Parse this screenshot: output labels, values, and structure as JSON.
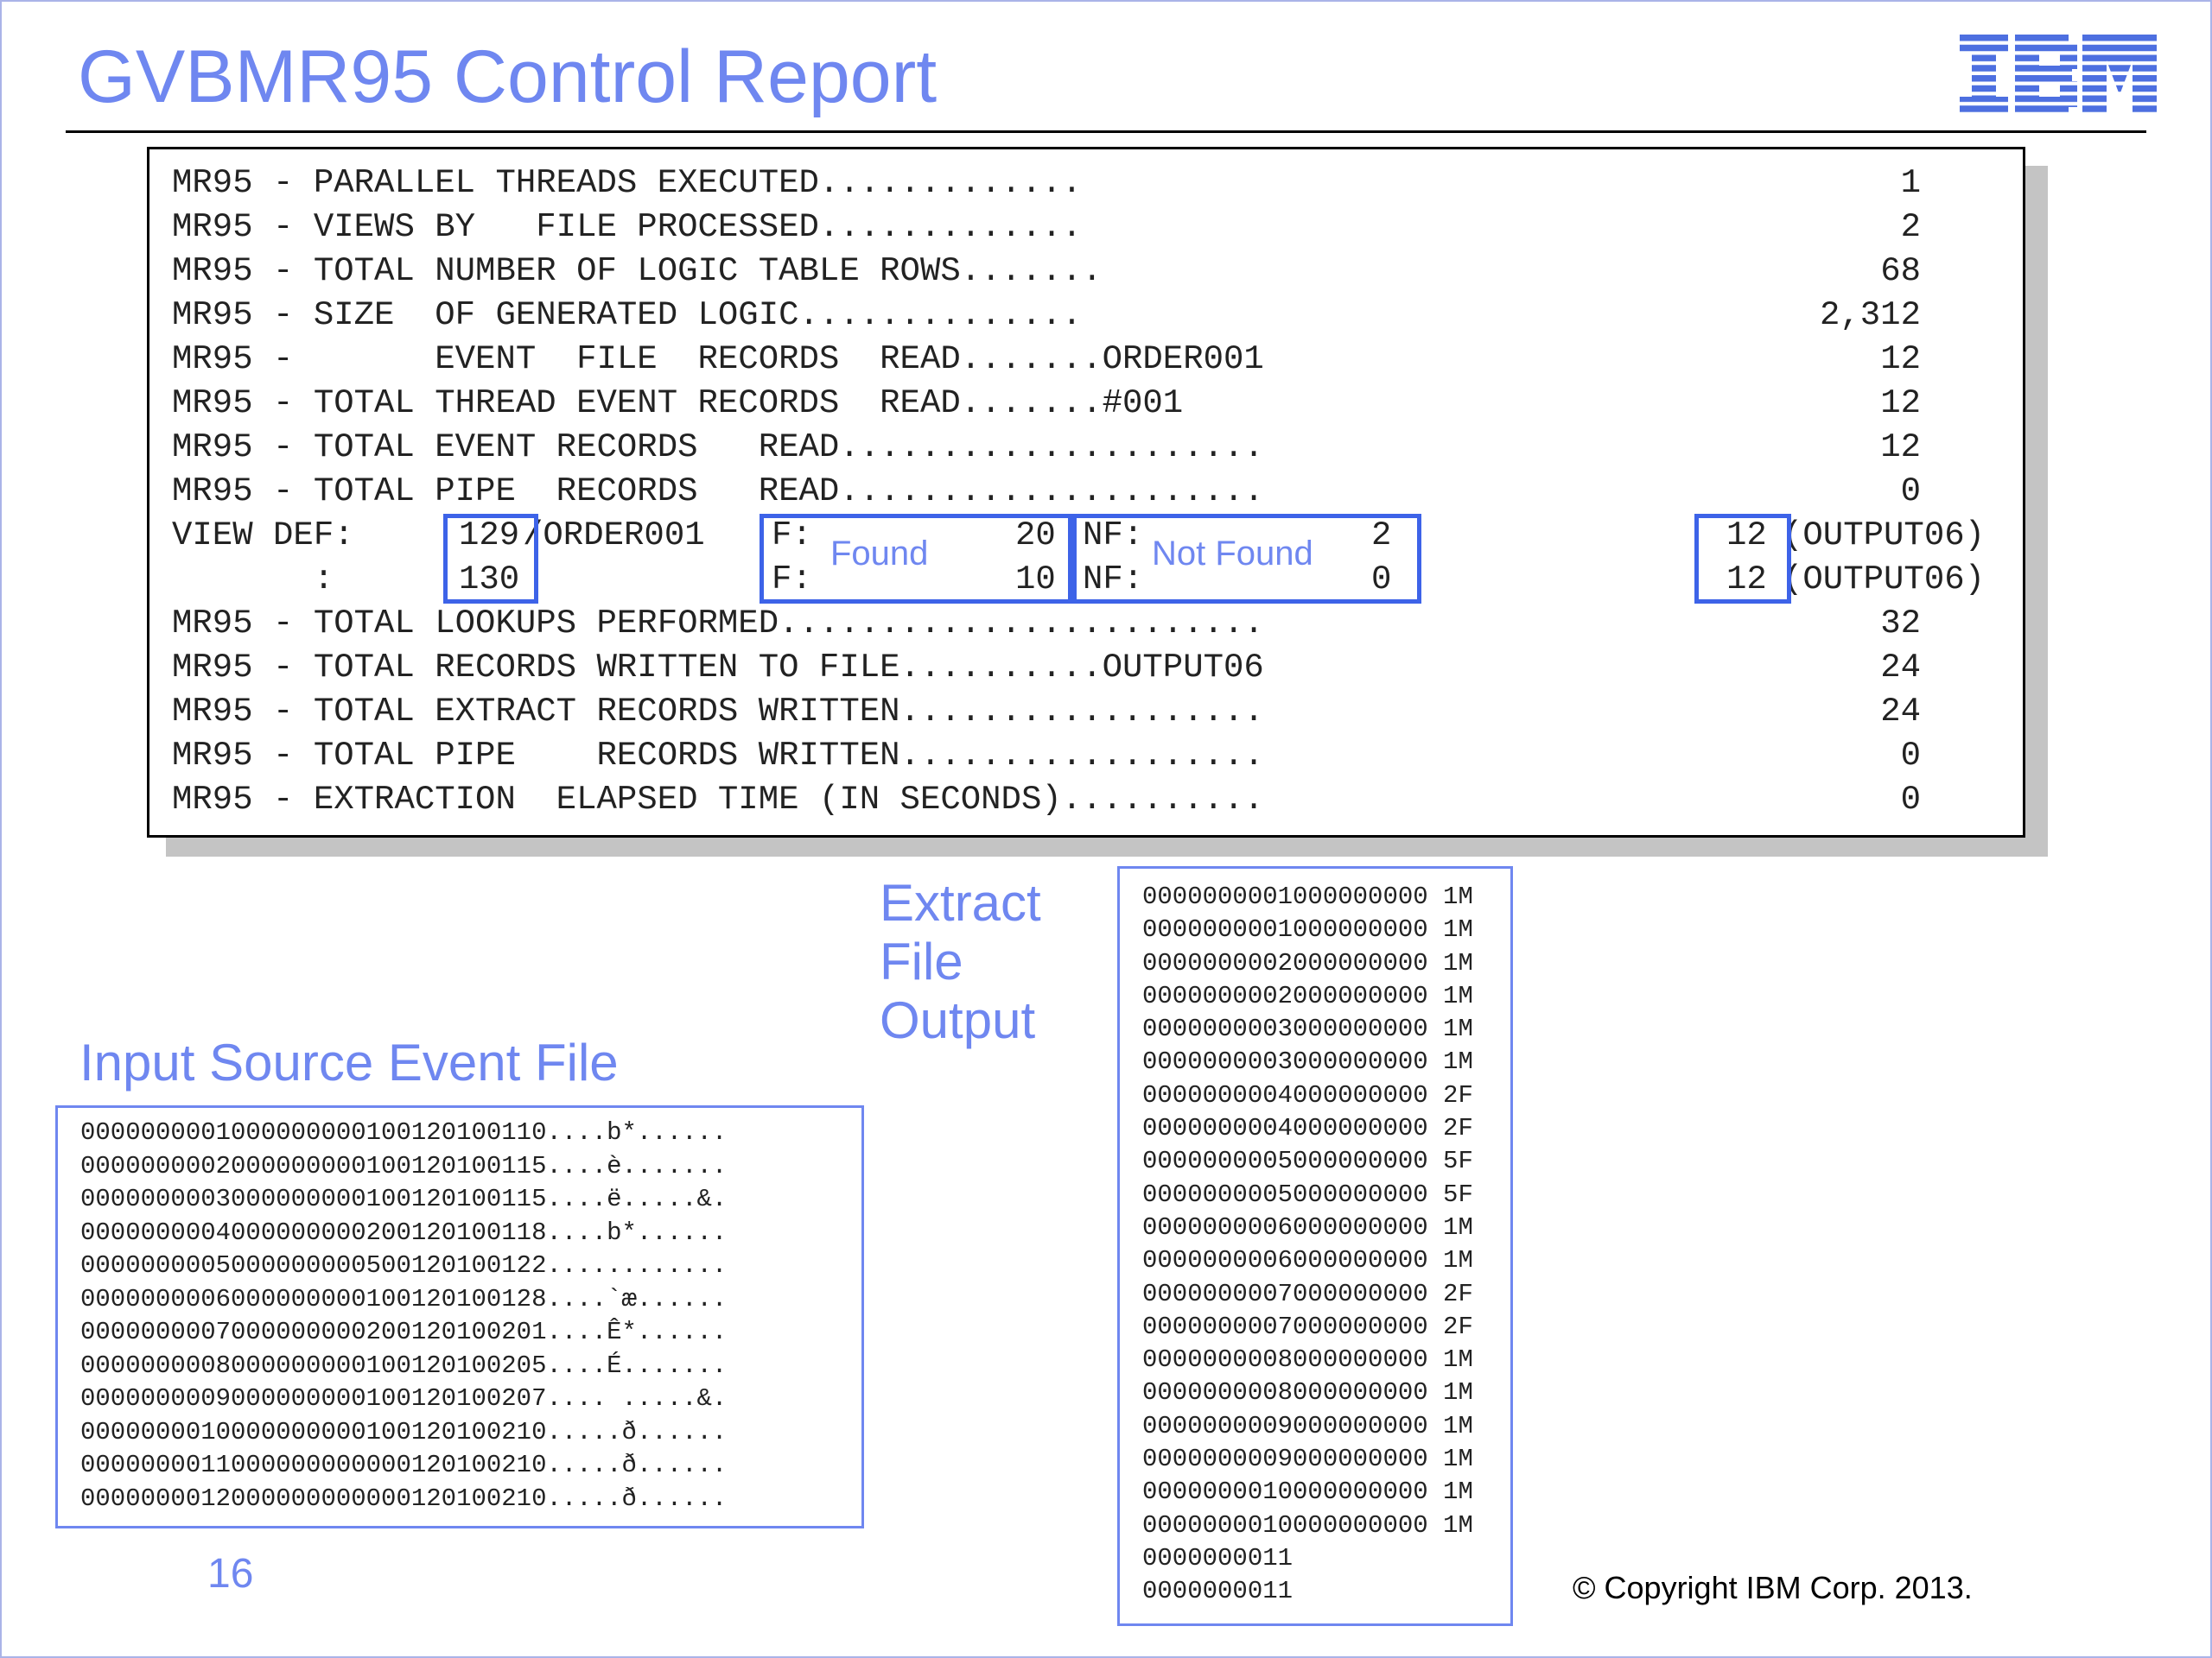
{
  "title": "GVBMR95 Control Report",
  "logo_text": "IBM",
  "report": {
    "rows": [
      {
        "label": "MR95 - PARALLEL THREADS EXECUTED.............",
        "value": "1"
      },
      {
        "label": "MR95 - VIEWS BY   FILE PROCESSED.............",
        "value": "2"
      },
      {
        "label": "MR95 - TOTAL NUMBER OF LOGIC TABLE ROWS.......",
        "value": "68"
      },
      {
        "label": "MR95 - SIZE  OF GENERATED LOGIC..............",
        "value": "2,312"
      },
      {
        "label": "MR95 -       EVENT  FILE  RECORDS  READ.......ORDER001",
        "value": "12"
      },
      {
        "label": "MR95 - TOTAL THREAD EVENT RECORDS  READ.......#001",
        "value": "12"
      },
      {
        "label": "MR95 - TOTAL EVENT RECORDS   READ.....................",
        "value": "12"
      },
      {
        "label": "MR95 - TOTAL PIPE  RECORDS   READ.....................",
        "value": "0"
      }
    ],
    "view_def": [
      {
        "prefix": "VIEW DEF:",
        "id": "129",
        "file": "/ORDER001",
        "found_label": "F:",
        "found": "20",
        "notfound_label": "NF:",
        "notfound": "2",
        "value": "12",
        "output": "(OUTPUT06)"
      },
      {
        "prefix": "       :",
        "id": "130",
        "file": "",
        "found_label": "F:",
        "found": "10",
        "notfound_label": "NF:",
        "notfound": "0",
        "value": "12",
        "output": "(OUTPUT06)"
      }
    ],
    "rows2": [
      {
        "label": "MR95 - TOTAL LOOKUPS PERFORMED........................",
        "value": "32"
      },
      {
        "label": "MR95 - TOTAL RECORDS WRITTEN TO FILE..........OUTPUT06",
        "value": "24"
      },
      {
        "label": "MR95 - TOTAL EXTRACT RECORDS WRITTEN..................",
        "value": "24"
      },
      {
        "label": "MR95 - TOTAL PIPE    RECORDS WRITTEN..................",
        "value": "0"
      },
      {
        "label": "MR95 - EXTRACTION  ELAPSED TIME (IN SECONDS)..........",
        "value": "0"
      }
    ],
    "callout_found": "Found",
    "callout_notfound": "Not Found"
  },
  "extract": {
    "title_lines": [
      "Extract",
      "File",
      "Output"
    ],
    "lines": [
      "0000000001000000000 1M",
      "0000000001000000000 1M",
      "0000000002000000000 1M",
      "0000000002000000000 1M",
      "0000000003000000000 1M",
      "0000000003000000000 1M",
      "0000000004000000000 2F",
      "0000000004000000000 2F",
      "0000000005000000000 5F",
      "0000000005000000000 5F",
      "0000000006000000000 1M",
      "0000000006000000000 1M",
      "0000000007000000000 2F",
      "0000000007000000000 2F",
      "0000000008000000000 1M",
      "0000000008000000000 1M",
      "0000000009000000000 1M",
      "0000000009000000000 1M",
      "0000000010000000000 1M",
      "0000000010000000000 1M",
      "0000000011",
      "0000000011"
    ]
  },
  "input": {
    "title": "Input Source Event File",
    "lines": [
      "0000000001000000000100120100110....b*......",
      "0000000002000000000100120100115....è.......",
      "0000000003000000000100120100115....ë.....&.",
      "0000000004000000000200120100118....b*......",
      "0000000005000000000500120100122............",
      "0000000006000000000100120100128....`æ......",
      "0000000007000000000200120100201....Ê*......",
      "0000000008000000000100120100205....É.......",
      "0000000009000000000100120100207.... .....&.",
      "0000000010000000000100120100210.....ð......",
      "0000000011000000000000120100210.....ð......",
      "0000000012000000000000120100210.....ð......"
    ]
  },
  "page_number": "16",
  "copyright": "© Copyright IBM Corp. 2013.",
  "colors": {
    "accent": "#6f87f0",
    "highlight": "#3d63e8"
  }
}
